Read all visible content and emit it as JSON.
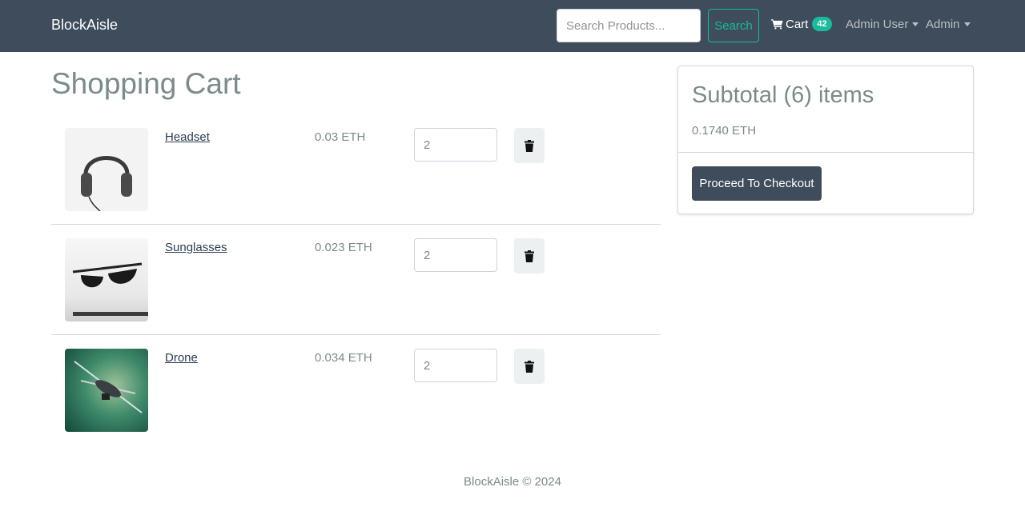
{
  "navbar": {
    "brand": "BlockAisle",
    "search_placeholder": "Search Products...",
    "search_label": "Search",
    "cart_label": "Cart",
    "cart_count": "42",
    "user_menu": "Admin User",
    "admin_menu": "Admin"
  },
  "page": {
    "title": "Shopping Cart"
  },
  "cart": {
    "items": [
      {
        "name": "Headset",
        "price": "0.03 ETH",
        "qty": "2",
        "image": "headphones"
      },
      {
        "name": "Sunglasses",
        "price": "0.023 ETH",
        "qty": "2",
        "image": "sunglasses"
      },
      {
        "name": "Drone",
        "price": "0.034 ETH",
        "qty": "2",
        "image": "drone"
      }
    ]
  },
  "summary": {
    "title": "Subtotal (6) items",
    "total": "0.1740 ETH",
    "checkout_label": "Proceed To Checkout"
  },
  "footer": {
    "text": "BlockAisle © 2024"
  },
  "colors": {
    "navbar": "#3e4c5b",
    "accent": "#18bc9c",
    "text": "#7b8a8b",
    "link": "#2c3e50"
  },
  "icons": {
    "cart": "cart-icon",
    "delete": "trash-icon",
    "caret": "caret-down-icon"
  }
}
